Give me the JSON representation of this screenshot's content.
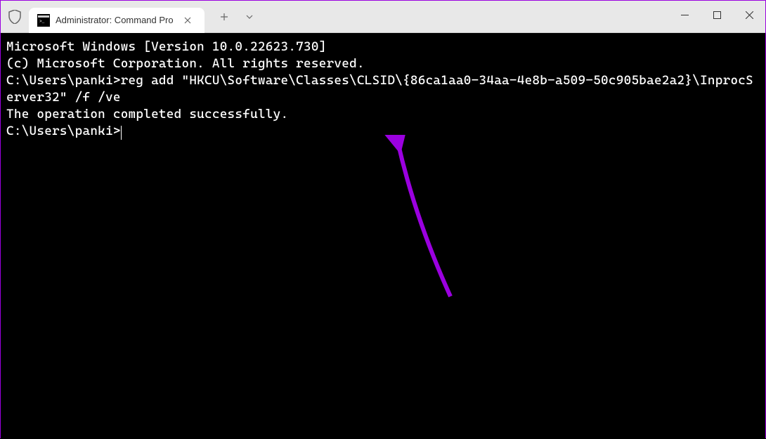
{
  "titlebar": {
    "tab_title": "Administrator: Command Pro"
  },
  "terminal": {
    "line1": "Microsoft Windows [Version 10.0.22623.730]",
    "line2": "(c) Microsoft Corporation. All rights reserved.",
    "blank1": "",
    "prompt1": "C:\\Users\\panki>",
    "command1": "reg add \"HKCU\\Software\\Classes\\CLSID\\{86ca1aa0-34aa-4e8b-a509-50c905bae2a2}\\InprocServer32\" /f /ve",
    "result1": "The operation completed successfully.",
    "blank2": "",
    "prompt2": "C:\\Users\\panki>"
  }
}
